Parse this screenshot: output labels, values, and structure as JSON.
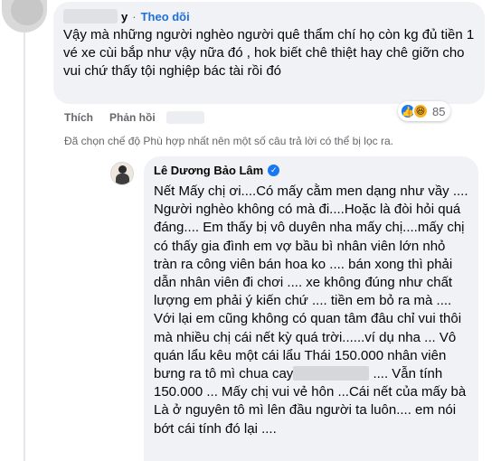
{
  "comment1": {
    "author_suffix": "y",
    "separator": "·",
    "follow_label": "Theo dõi",
    "text": "Vậy mà những người nghèo người quê thẩm chí họ còn kg đủ tiền 1 vé xe cùi bắp như vậy nữa đó , hok biết chê thiệt hay chê giỡn cho vui chứ thấy tội nghiệp bác tài rồi đó",
    "like_label": "Thích",
    "reply_label": "Phản hồi",
    "reaction_icons": [
      "like-icon",
      "haha-icon"
    ],
    "reaction_count": "85"
  },
  "filter_note": "Đã chọn chế độ Phù hợp nhất nên một số câu trả lời có thể bị lọc ra.",
  "reply": {
    "author": "Lê Dương Bảo Lâm",
    "verified_icon": "verified-badge-icon",
    "text_before": "Nết Mấy chị ơi....Có mấy cằm men dạng như vầy .... Người nghèo không có mà đi....Hoặc là đòi hỏi quá đáng.... Em thấy bị vô duyên nha mấy chị....mấy chị có thấy gia đình em vợ bầu bì nhân viên lớn nhỏ tràn ra công viên bán hoa ko .... bán xong thì phải dẫn nhân viên đi chơi .... xe không đúng như chất lượng em phải ý kiến chứ .... tiền em bỏ ra mà .... Với lại em cũng không có quan tâm đâu chỉ vui thôi mà nhiều chị cái nết kỳ quá trời......ví dụ nha ... Vô quán lẩu kêu một cái lẩu Thái 150.000 nhân viên bưng ra tô mì chua cay",
    "text_after": " .... Vẫn tính 150.000 ... Mấy chị vui vẻ hôn ...Cái nết của mấy bà Là ở nguyên tô mì lên đầu người ta luôn.... em nói bớt cái tính đó lại ...."
  },
  "colors": {
    "bubble_bg": "#f0f2f5",
    "secondary_text": "#65676b",
    "link_blue": "#216fdb",
    "facebook_blue": "#1877f2"
  }
}
